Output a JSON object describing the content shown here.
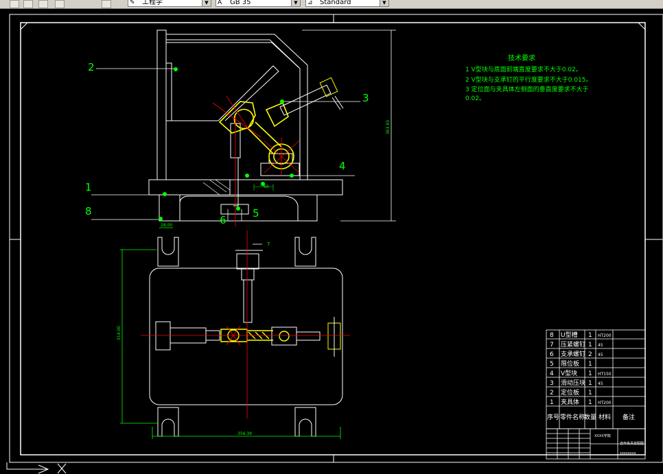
{
  "toolbar": {
    "workspace_combo": "工程学",
    "text_style_combo": "GB 35",
    "dim_style_combo": "Standard"
  },
  "drawing": {
    "tech_title": "技术要求",
    "tech_notes": [
      "1  V型块与底面前端直度要求不大于0.02。",
      "2  V型块与支承钉的平行度要求不大于0.015。",
      "3  定位面与夹具体左侧面的垂直度要求不大于",
      "0.02。"
    ],
    "balloons": [
      "2",
      "3",
      "4",
      "1",
      "8",
      "6",
      "5",
      "7"
    ],
    "dimensions": {
      "height_right": "363.93",
      "small_center": "60",
      "left_vertical": "314.00",
      "top_small": "28.00",
      "bottom_width": "356.39"
    }
  },
  "bom": {
    "rows": [
      {
        "no": "8",
        "name": "U型槽",
        "qty": "1",
        "material": "HT200"
      },
      {
        "no": "7",
        "name": "压紧螺钉",
        "qty": "1",
        "material": "45"
      },
      {
        "no": "6",
        "name": "支承螺钉",
        "qty": "2",
        "material": "45"
      },
      {
        "no": "5",
        "name": "限位板",
        "qty": "1",
        "material": ""
      },
      {
        "no": "4",
        "name": "V型块",
        "qty": "1",
        "material": "HT150"
      },
      {
        "no": "3",
        "name": "滑动压块",
        "qty": "1",
        "material": "45"
      },
      {
        "no": "2",
        "name": "定位板",
        "qty": "1",
        "material": ""
      },
      {
        "no": "1",
        "name": "夹具体",
        "qty": "1",
        "material": "HT200"
      }
    ],
    "headers": {
      "no": "序号",
      "name": "零件名称",
      "qty": "数量",
      "material": "材料",
      "remark": "备注"
    },
    "title_block": {
      "school": "XXXX学院",
      "drawing_name": "连杆夹具装配图",
      "drawing_no": "xxxxxxxx"
    }
  },
  "colors": {
    "green": "#00ff00",
    "white": "#ffffff",
    "yellow": "#ffff00",
    "red": "#ff0000",
    "cyan": "#00cccc"
  }
}
